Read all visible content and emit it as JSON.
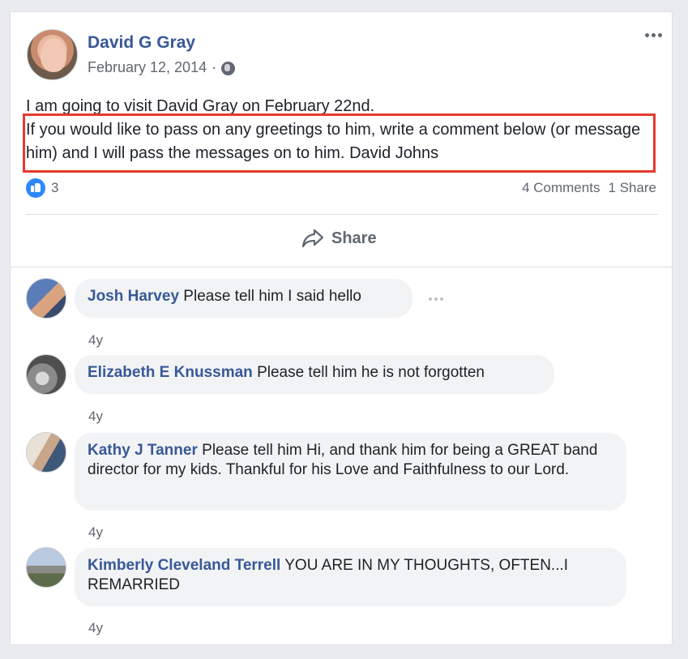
{
  "post": {
    "author": "David G Gray",
    "date": "February 12, 2014",
    "separator": "·",
    "privacy_icon": "globe-icon",
    "text_line1": "I am going to visit David Gray on February 22nd.",
    "text_highlighted": "If you would like to pass on any greetings to him, write a comment below (or message him) and I will pass the messages on to him. David Johns",
    "likes": "3",
    "comments_count": "4 Comments",
    "shares_count": "1 Share",
    "share_label": "Share"
  },
  "comments": [
    {
      "name": "Josh Harvey",
      "text": "Please tell him I said hello",
      "time": "4y"
    },
    {
      "name": "Elizabeth E Knussman",
      "text": "Please tell him he is not forgotten",
      "time": "4y"
    },
    {
      "name": "Kathy J Tanner",
      "text": "Please tell him Hi, and thank him for being a GREAT band director for my kids. Thankful for his Love and Faithfulness to our Lord.",
      "time": "4y"
    },
    {
      "name": "Kimberly Cleveland Terrell",
      "text": "YOU ARE IN MY THOUGHTS, OFTEN...I REMARRIED",
      "time": "4y"
    }
  ],
  "colors": {
    "link": "#385898",
    "highlight_border": "#e63b2e",
    "like_blue": "#2d88ff"
  }
}
